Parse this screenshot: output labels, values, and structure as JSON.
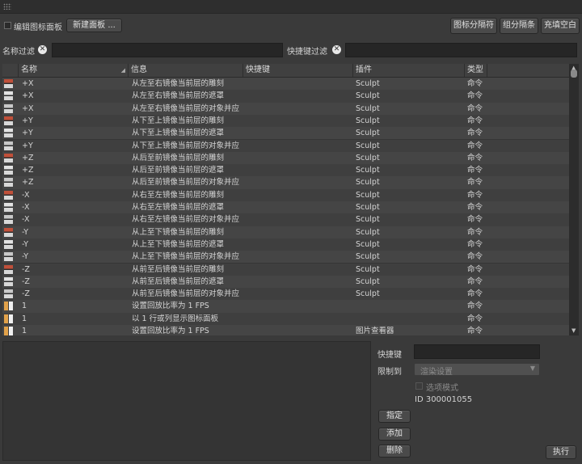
{
  "toolbar": {
    "edit_palette_label": "编辑图标面板",
    "new_palette_button": "新建面板 ...",
    "separator_button": "图标分隔符",
    "group_separator_button": "组分隔条",
    "fill_space_button": "充填空白"
  },
  "filters": {
    "name_filter_label": "名称过滤",
    "shortcut_filter_label": "快捷键过滤",
    "name_filter_value": "",
    "shortcut_filter_value": ""
  },
  "table": {
    "columns": [
      "名称",
      "信息",
      "快捷键",
      "插件",
      "类型"
    ],
    "rows": [
      {
        "name": "+X",
        "info": "从左至右镜像当前层的雕刻",
        "shortcut": "",
        "plugin": "Sculpt",
        "type": "命令"
      },
      {
        "name": "+X",
        "info": "从左至右镜像当前层的遮罩",
        "shortcut": "",
        "plugin": "Sculpt",
        "type": "命令"
      },
      {
        "name": "+X",
        "info": "从左至右镜像当前层的对象并应",
        "shortcut": "",
        "plugin": "Sculpt",
        "type": "命令"
      },
      {
        "name": "+Y",
        "info": "从下至上镜像当前层的雕刻",
        "shortcut": "",
        "plugin": "Sculpt",
        "type": "命令"
      },
      {
        "name": "+Y",
        "info": "从下至上镜像当前层的遮罩",
        "shortcut": "",
        "plugin": "Sculpt",
        "type": "命令"
      },
      {
        "name": "+Y",
        "info": "从下至上镜像当前层的对象并应",
        "shortcut": "",
        "plugin": "Sculpt",
        "type": "命令"
      },
      {
        "name": "+Z",
        "info": "从后至前镜像当前层的雕刻",
        "shortcut": "",
        "plugin": "Sculpt",
        "type": "命令"
      },
      {
        "name": "+Z",
        "info": "从后至前镜像当前层的遮罩",
        "shortcut": "",
        "plugin": "Sculpt",
        "type": "命令"
      },
      {
        "name": "+Z",
        "info": "从后至前镜像当前层的对象并应",
        "shortcut": "",
        "plugin": "Sculpt",
        "type": "命令"
      },
      {
        "name": "-X",
        "info": "从右至左镜像当前层的雕刻",
        "shortcut": "",
        "plugin": "Sculpt",
        "type": "命令"
      },
      {
        "name": "-X",
        "info": "从右至左镜像当前层的遮罩",
        "shortcut": "",
        "plugin": "Sculpt",
        "type": "命令"
      },
      {
        "name": "-X",
        "info": "从右至左镜像当前层的对象并应",
        "shortcut": "",
        "plugin": "Sculpt",
        "type": "命令"
      },
      {
        "name": "-Y",
        "info": "从上至下镜像当前层的雕刻",
        "shortcut": "",
        "plugin": "Sculpt",
        "type": "命令"
      },
      {
        "name": "-Y",
        "info": "从上至下镜像当前层的遮罩",
        "shortcut": "",
        "plugin": "Sculpt",
        "type": "命令"
      },
      {
        "name": "-Y",
        "info": "从上至下镜像当前层的对象并应",
        "shortcut": "",
        "plugin": "Sculpt",
        "type": "命令"
      },
      {
        "name": "-Z",
        "info": "从前至后镜像当前层的雕刻",
        "shortcut": "",
        "plugin": "Sculpt",
        "type": "命令"
      },
      {
        "name": "-Z",
        "info": "从前至后镜像当前层的遮罩",
        "shortcut": "",
        "plugin": "Sculpt",
        "type": "命令"
      },
      {
        "name": "-Z",
        "info": "从前至后镜像当前层的对象并应",
        "shortcut": "",
        "plugin": "Sculpt",
        "type": "命令"
      },
      {
        "name": "1",
        "info": "设置回放比率为 1 FPS",
        "shortcut": "",
        "plugin": "",
        "type": "命令"
      },
      {
        "name": "1",
        "info": "以 1 行或列显示图标面板",
        "shortcut": "",
        "plugin": "",
        "type": "命令"
      },
      {
        "name": "1",
        "info": "设置回放比率为 1 FPS",
        "shortcut": "",
        "plugin": "图片查看器",
        "type": "命令"
      }
    ]
  },
  "details": {
    "shortcut_label": "快捷键",
    "shortcut_value": "",
    "restrict_label": "限制到",
    "restrict_value": "渲染设置",
    "option_mode_label": "选项模式",
    "id_text": "ID 300001055",
    "assign_button": "指定",
    "add_button": "添加",
    "delete_button": "删除",
    "execute_button": "执行"
  }
}
